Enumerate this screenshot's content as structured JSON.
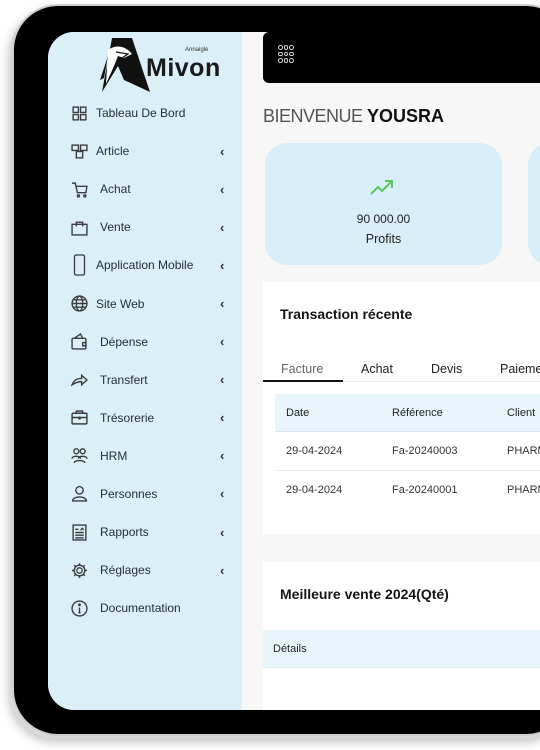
{
  "brand": {
    "name": "Mivon",
    "tagline": "Annaigle"
  },
  "sidebar": {
    "items": [
      {
        "label": "Tableau De Bord",
        "icon": "dashboard-icon",
        "expandable": false
      },
      {
        "label": "Article",
        "icon": "boxes-icon",
        "expandable": true
      },
      {
        "label": "Achat",
        "icon": "cart-icon",
        "expandable": true
      },
      {
        "label": "Vente",
        "icon": "shopping-bag-icon",
        "expandable": true
      },
      {
        "label": "Application Mobile",
        "icon": "mobile-icon",
        "expandable": true
      },
      {
        "label": "Site Web",
        "icon": "globe-icon",
        "expandable": true
      },
      {
        "label": "Dépense",
        "icon": "wallet-icon",
        "expandable": true
      },
      {
        "label": "Transfert",
        "icon": "share-arrow-icon",
        "expandable": true
      },
      {
        "label": "Trésorerie",
        "icon": "briefcase-icon",
        "expandable": true
      },
      {
        "label": "HRM",
        "icon": "users-group-icon",
        "expandable": true
      },
      {
        "label": "Personnes",
        "icon": "person-icon",
        "expandable": true
      },
      {
        "label": "Rapports",
        "icon": "report-icon",
        "expandable": true
      },
      {
        "label": "Réglages",
        "icon": "gear-icon",
        "expandable": true
      },
      {
        "label": "Documentation",
        "icon": "info-icon",
        "expandable": false
      }
    ],
    "chevron": "‹"
  },
  "header": {
    "welcome": "BIENVENUE ",
    "user": "YOUSRA"
  },
  "cards": [
    {
      "value": "90 000.00",
      "label": "Profits",
      "icon": "trend-up-icon",
      "icon_color": "#5cc85a"
    }
  ],
  "transactions": {
    "title": "Transaction récente",
    "tabs": [
      "Facture",
      "Achat",
      "Devis",
      "Paiement"
    ],
    "active_tab": "Facture",
    "columns": [
      "Date",
      "Référence",
      "Client"
    ],
    "rows": [
      [
        "29-04-2024",
        "Fa-20240003",
        "PHARMAC"
      ],
      [
        "29-04-2024",
        "Fa-20240001",
        "PHARMAC"
      ]
    ]
  },
  "best_sales": {
    "title": "Meilleure vente 2024(Qté)",
    "columns": [
      "Détails"
    ]
  },
  "colors": {
    "sidebar_bg": "#dbeff8",
    "card_bg": "#d8eef8",
    "table_head_bg": "#e8f5fb",
    "topbar_bg": "#000000"
  }
}
